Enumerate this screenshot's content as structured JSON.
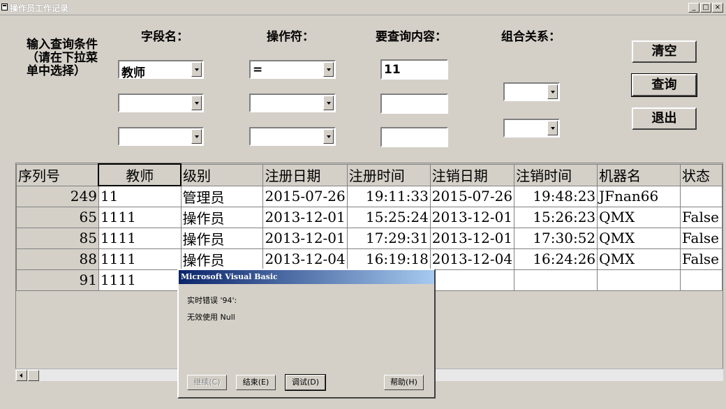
{
  "window": {
    "title": "操作员工作记录",
    "controls": {
      "minimize": "_",
      "maximize": "□",
      "close": "×"
    }
  },
  "form": {
    "prompt": "输入查询条件（请在下拉菜单中选择）",
    "headers": {
      "field_name": "字段名：",
      "operator": "操作符：",
      "content": "要查询内容：",
      "combine": "组合关系："
    },
    "rows": [
      {
        "field": "教师",
        "operator": "=",
        "content": "11"
      },
      {
        "field": "",
        "operator": "",
        "content": ""
      },
      {
        "field": "",
        "operator": "",
        "content": ""
      }
    ],
    "combine_values": [
      "",
      ""
    ],
    "buttons": {
      "clear": "清空",
      "query": "查询",
      "exit": "退出"
    }
  },
  "grid": {
    "columns": [
      "序列号",
      "教师",
      "级别",
      "注册日期",
      "注册时间",
      "注销日期",
      "注销时间",
      "机器名",
      "状态"
    ],
    "rows": [
      {
        "id": "249",
        "teacher": "11",
        "level": "管理员",
        "reg_date": "2015-07-26",
        "reg_time": "19:11:33",
        "out_date": "2015-07-26",
        "out_time": "19:48:23",
        "machine": "JFnan66",
        "status": ""
      },
      {
        "id": "65",
        "teacher": "1111",
        "level": "操作员",
        "reg_date": "2013-12-01",
        "reg_time": "15:25:24",
        "out_date": "2013-12-01",
        "out_time": "15:26:23",
        "machine": "QMX",
        "status": "False"
      },
      {
        "id": "85",
        "teacher": "1111",
        "level": "操作员",
        "reg_date": "2013-12-01",
        "reg_time": "17:29:31",
        "out_date": "2013-12-01",
        "out_time": "17:30:52",
        "machine": "QMX",
        "status": "False"
      },
      {
        "id": "88",
        "teacher": "1111",
        "level": "操作员",
        "reg_date": "2013-12-04",
        "reg_time": "16:19:18",
        "out_date": "2013-12-04",
        "out_time": "16:24:26",
        "machine": "QMX",
        "status": "False"
      },
      {
        "id": "91",
        "teacher": "1111",
        "level": "",
        "reg_date": "",
        "reg_time": "",
        "out_date": "",
        "out_time": "",
        "machine": "",
        "status": ""
      }
    ]
  },
  "dialog": {
    "title": "Microsoft Visual Basic",
    "message1": "实时错误 '94':",
    "message2": "无效使用 Null",
    "buttons": {
      "continue": "继续(C)",
      "end": "结束(E)",
      "debug": "调试(D)",
      "help": "帮助(H)"
    }
  }
}
